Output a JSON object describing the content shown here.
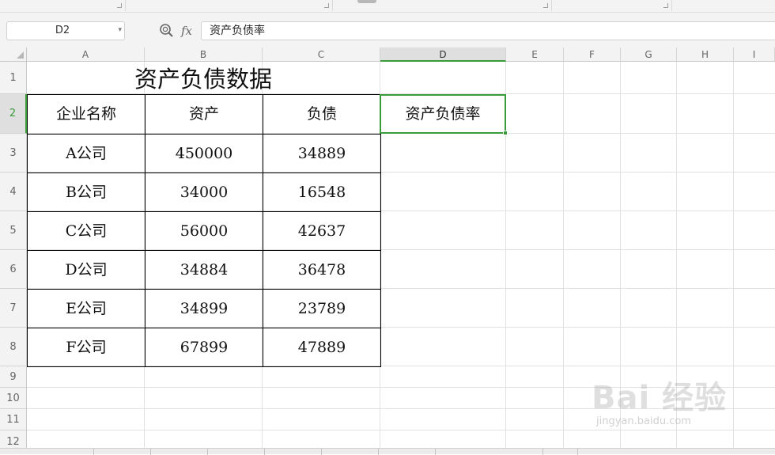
{
  "name_box": {
    "value": "D2"
  },
  "formula_bar": {
    "fx_label": "fx",
    "content": "资产负债率"
  },
  "columns": [
    "A",
    "B",
    "C",
    "D",
    "E",
    "F",
    "G",
    "H",
    "I"
  ],
  "rows": [
    "1",
    "2",
    "3",
    "4",
    "5",
    "6",
    "7",
    "8",
    "9",
    "10",
    "11",
    "12"
  ],
  "active_cell": {
    "column": "D",
    "row": "2"
  },
  "sheet": {
    "title": "资产负债数据",
    "headers": [
      "企业名称",
      "资产",
      "负债"
    ],
    "selected_cell_text": "资产负债率",
    "table": [
      [
        "A公司",
        "450000",
        "34889"
      ],
      [
        "B公司",
        "34000",
        "16548"
      ],
      [
        "C公司",
        "56000",
        "42637"
      ],
      [
        "D公司",
        "34884",
        "36478"
      ],
      [
        "E公司",
        "34899",
        "23789"
      ],
      [
        "F公司",
        "67899",
        "47889"
      ]
    ]
  },
  "watermark": {
    "text": "Bai 经验",
    "sub": "jingyan.baidu.com"
  },
  "colors": {
    "selection": "#3a9b3a",
    "header_bg": "#f3f3f3",
    "grid_line": "#e1e1e1"
  }
}
